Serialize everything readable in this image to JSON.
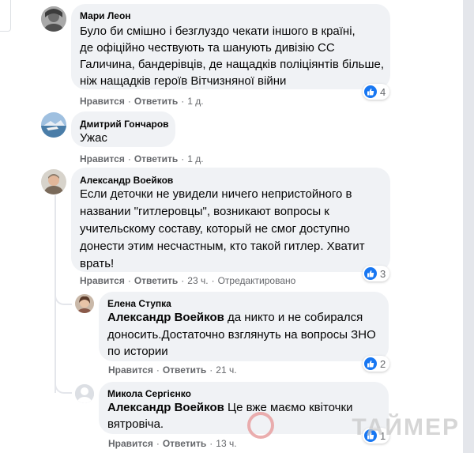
{
  "comments": [
    {
      "author": "Мари Леон",
      "lines": [
        "Було би смішно і безглуздо чекати іншого в країні,",
        "де офіційно чествують та шанують дивізію СС",
        "Галичина, бандерівців, де нащадків поліціянтів більше,",
        "ніж нащадків героїв Вітчизняної війни"
      ],
      "like": "Нравится",
      "reply": "Ответить",
      "time": "1 д.",
      "reactions": "4"
    },
    {
      "author": "Дмитрий Гончаров",
      "lines": [
        "Ужас"
      ],
      "like": "Нравится",
      "reply": "Ответить",
      "time": "1 д."
    },
    {
      "author": "Александр Воейков",
      "lines": [
        "Если деточки не увидели ничего непристойного в",
        "названии \"гитлеровцы\", возникают вопросы к",
        "учительскому составу, который не смог доступно",
        "донести этим несчастным, кто такой гитлер. Хватит",
        "врать!"
      ],
      "like": "Нравится",
      "reply": "Ответить",
      "time": "23 ч.",
      "edited": "Отредактировано",
      "reactions": "3"
    }
  ],
  "replies": [
    {
      "author": "Елена Ступка",
      "mention": "Александр Воейков",
      "first_rest": " да никто и не собирался",
      "lines": [
        "доносить.Достаточно взглянуть на вопросы ЗНО",
        "по истории"
      ],
      "like": "Нравится",
      "reply": "Ответить",
      "time": "21 ч.",
      "reactions": "2"
    },
    {
      "author": "Микола Сергієнко",
      "mention": "Александр Воейков",
      "first_rest": " Це вже маємо квіточки",
      "lines": [
        "вятровiча."
      ],
      "like": "Нравится",
      "reply": "Ответить",
      "time": "13 ч.",
      "reactions": "1"
    }
  ],
  "watermark": "ТАЙМЕР",
  "colors": {
    "bubble": "#f0f2f5",
    "meta": "#65676b",
    "like_blue": "#1877f2",
    "thread_line": "#e4e6eb"
  },
  "icons": [
    "thumbs-up-icon",
    "avatar-icon"
  ]
}
